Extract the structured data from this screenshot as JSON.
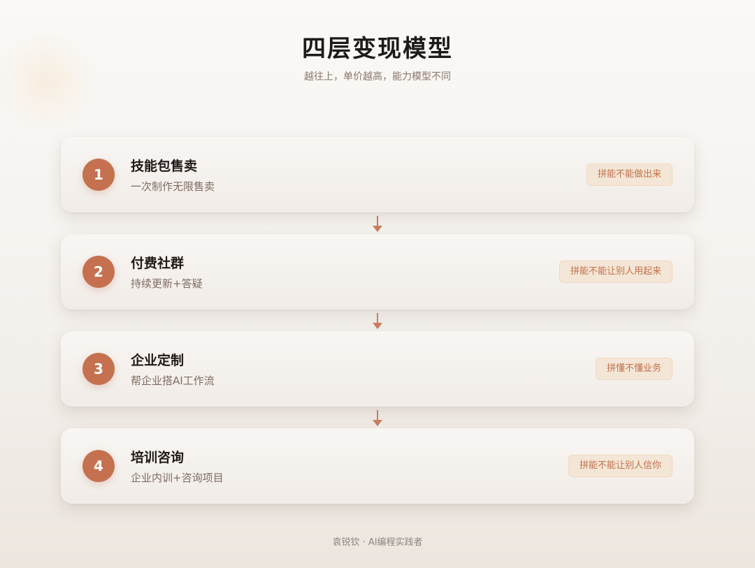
{
  "header": {
    "title": "四层变现模型",
    "subtitle": "越往上，单价越高，能力模型不同"
  },
  "tiers": [
    {
      "number": "1",
      "title": "技能包售卖",
      "description": "一次制作无限售卖",
      "tag": "拼能不能做出来"
    },
    {
      "number": "2",
      "title": "付费社群",
      "description": "持续更新+答疑",
      "tag": "拼能不能让别人用起来"
    },
    {
      "number": "3",
      "title": "企业定制",
      "description": "帮企业搭AI工作流",
      "tag": "拼懂不懂业务"
    },
    {
      "number": "4",
      "title": "培训咨询",
      "description": "企业内训+咨询项目",
      "tag": "拼能不能让别人信你"
    }
  ],
  "footer": {
    "credit": "袁锐钦 · AI编程实践者"
  },
  "colors": {
    "accent": "#c5714f",
    "tag_background": "#f4e6d6",
    "tag_text": "#c0704b",
    "arrow": "#c97d5c"
  },
  "icons": {
    "connector": "arrow-down-icon"
  }
}
